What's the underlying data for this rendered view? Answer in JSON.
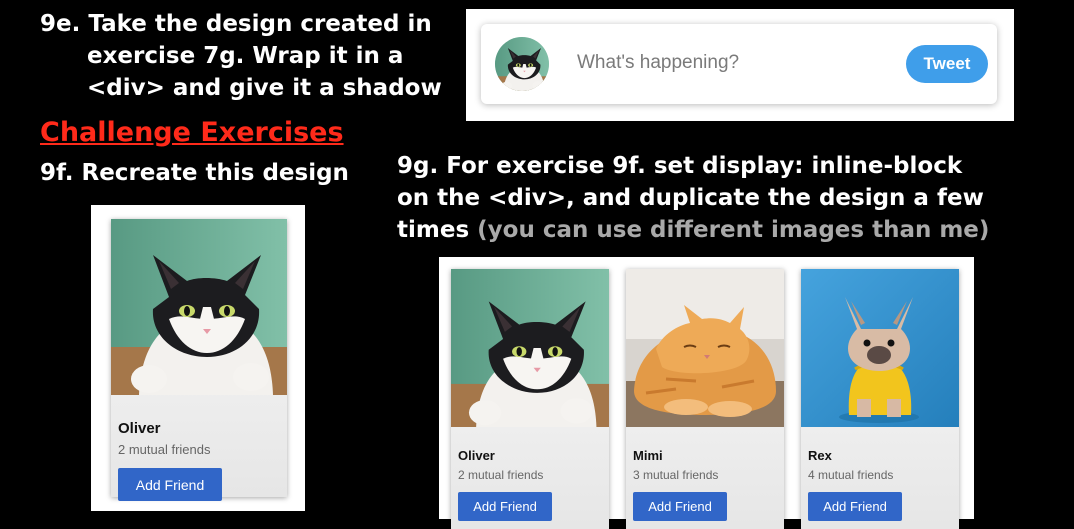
{
  "slide": {
    "ex9e": {
      "line1": "9e. Take the design created in",
      "line2": "exercise 7g. Wrap it in a",
      "line3": "<div> and give it a shadow"
    },
    "challenge_title": "Challenge Exercises",
    "ex9f": "9f. Recreate this design",
    "ex9g": {
      "line1": "9g. For exercise 9f. set display: inline-block",
      "line2": "on the <div>, and duplicate the design a few",
      "line3_main": "times",
      "line3_note": "(you can use different images than me)"
    }
  },
  "tweet": {
    "placeholder": "What's happening?",
    "button_label": "Tweet"
  },
  "single_card": {
    "name": "Oliver",
    "mutual": "2 mutual friends",
    "button_label": "Add Friend"
  },
  "cards": [
    {
      "name": "Oliver",
      "mutual": "2 mutual friends",
      "button_label": "Add Friend",
      "image": "cat-black-white"
    },
    {
      "name": "Mimi",
      "mutual": "3 mutual friends",
      "button_label": "Add Friend",
      "image": "cat-orange-tabby"
    },
    {
      "name": "Rex",
      "mutual": "4 mutual friends",
      "button_label": "Add Friend",
      "image": "french-bulldog-yellow-shirt"
    }
  ],
  "colors": {
    "challenge": "#ff2a1a",
    "tweet_button": "#3f9eea",
    "add_friend_button": "#3166c8"
  }
}
